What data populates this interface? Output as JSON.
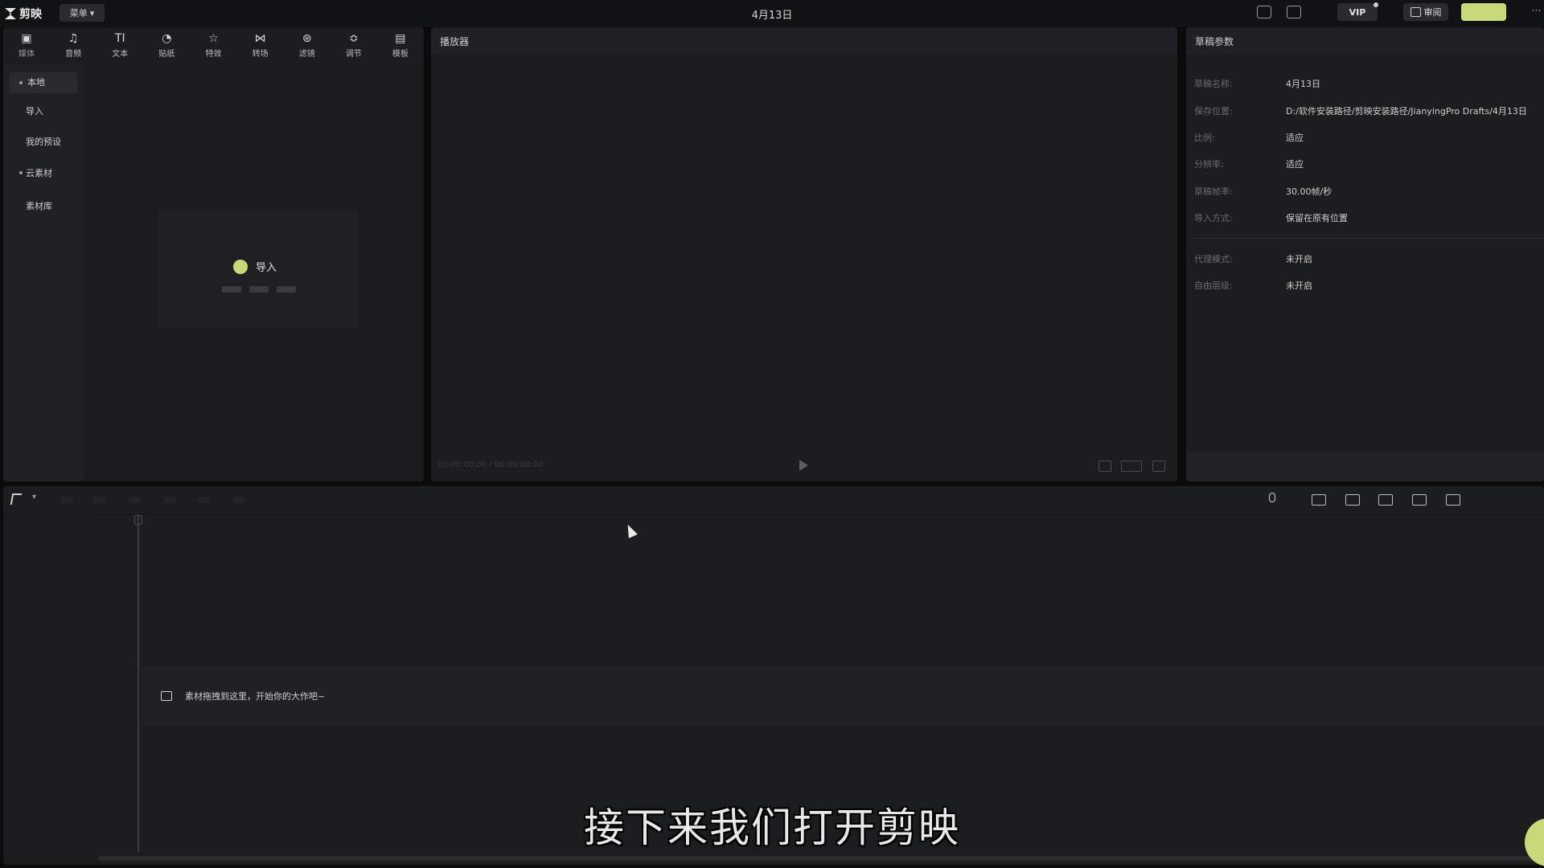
{
  "app": {
    "logo_text": "剪映",
    "menu_label": "菜单",
    "title": "4月13日",
    "vip_label": "VIP",
    "review_label": "审阅",
    "export_label": ""
  },
  "media_tabs": [
    {
      "label": "媒体",
      "icon": "media-icon"
    },
    {
      "label": "音频",
      "icon": "audio-icon"
    },
    {
      "label": "文本",
      "icon": "text-icon"
    },
    {
      "label": "贴纸",
      "icon": "sticker-icon"
    },
    {
      "label": "特效",
      "icon": "effects-icon"
    },
    {
      "label": "转场",
      "icon": "transition-icon"
    },
    {
      "label": "滤镜",
      "icon": "filter-icon"
    },
    {
      "label": "调节",
      "icon": "adjust-icon"
    },
    {
      "label": "模板",
      "icon": "template-icon"
    }
  ],
  "media_sidebar": {
    "items": [
      {
        "label": "本地"
      },
      {
        "label": "导入"
      },
      {
        "label": "我的预设"
      },
      {
        "label": "云素材"
      },
      {
        "label": "素材库"
      }
    ]
  },
  "import_card": {
    "label": "导入"
  },
  "player": {
    "title": "播放器",
    "timecode": "00:00:00:00 / 00:00:00:00"
  },
  "props": {
    "title": "草稿参数",
    "rows": [
      {
        "key": "草稿名称:",
        "value": "4月13日"
      },
      {
        "key": "保存位置:",
        "value": "D:/软件安装路径/剪映安装路径/JianyingPro Drafts/4月13日"
      },
      {
        "key": "比例:",
        "value": "适应"
      },
      {
        "key": "分辨率:",
        "value": "适应"
      },
      {
        "key": "草稿帧率:",
        "value": "30.00帧/秒"
      },
      {
        "key": "导入方式:",
        "value": "保留在原有位置"
      },
      {
        "key": "代理模式:",
        "value": "未开启"
      },
      {
        "key": "自由层级:",
        "value": "未开启"
      }
    ]
  },
  "timeline": {
    "drop_hint": "素材拖拽到这里，开始你的大作吧~"
  },
  "caption": "接下来我们打开剪映"
}
